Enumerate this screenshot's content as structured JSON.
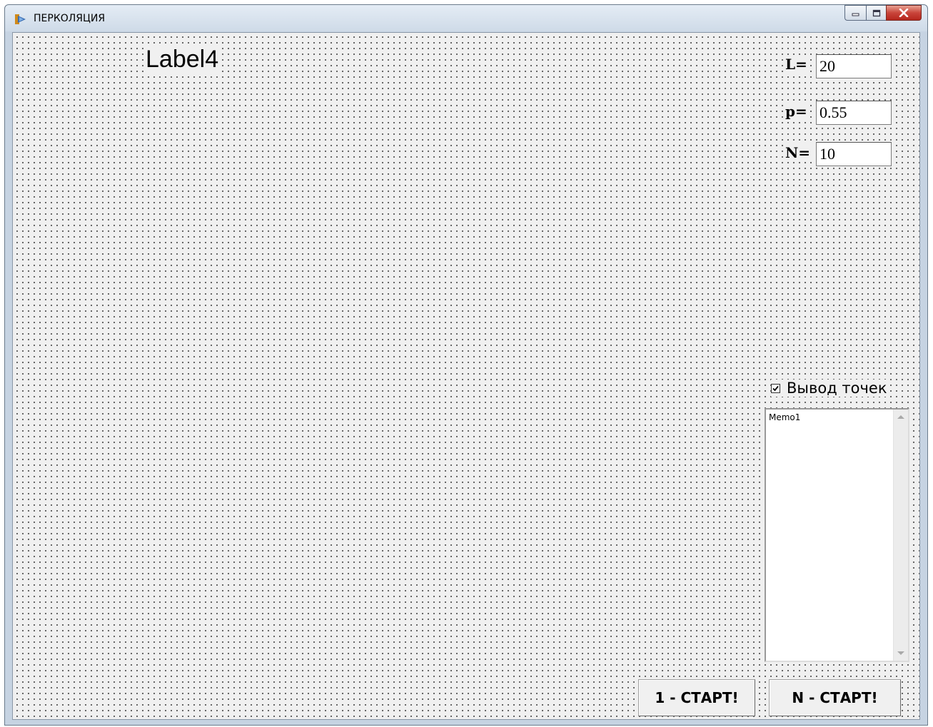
{
  "window": {
    "title": "ПЕРКОЛЯЦИЯ"
  },
  "form": {
    "label4": "Label4",
    "fields": [
      {
        "label": "L=",
        "value": "20"
      },
      {
        "label": "p=",
        "value": "0.55"
      },
      {
        "label": "N=",
        "value": "10"
      }
    ],
    "checkbox": {
      "label": "Вывод точек",
      "checked": true
    },
    "memo": {
      "text": "Memo1"
    },
    "buttons": {
      "start_one": "1 - СТАРТ!",
      "start_n": "N - СТАРТ!"
    }
  },
  "colors": {
    "form_bg": "#f0f0f0",
    "dot_grid": "#404040",
    "close_button": "#c9453a"
  }
}
